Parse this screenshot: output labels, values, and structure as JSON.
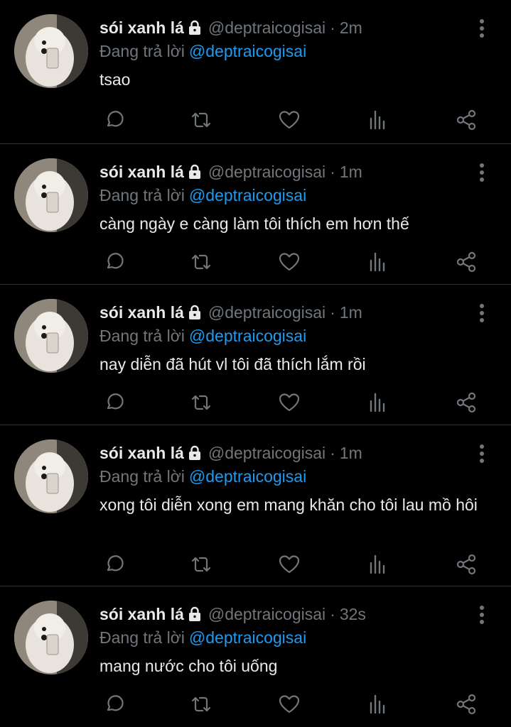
{
  "colors": {
    "background": "#000000",
    "text": "#e7e9ea",
    "muted": "#71767b",
    "link": "#1d9bf0",
    "divider": "#2f3336"
  },
  "icons": {
    "lock": "lock-icon",
    "more": "more-vertical-icon",
    "reply": "reply-icon",
    "retweet": "retweet-icon",
    "like": "heart-icon",
    "views": "views-icon",
    "share": "share-icon"
  },
  "tweets": [
    {
      "name": "sói xanh lá",
      "handle": "@deptraicogisai",
      "sep": "·",
      "time": "2m",
      "reply_prefix": "Đang trả lời",
      "reply_to": "@deptraicogisai",
      "text": "tsao"
    },
    {
      "name": "sói xanh lá",
      "handle": "@deptraicogisai",
      "sep": "·",
      "time": "1m",
      "reply_prefix": "Đang trả lời",
      "reply_to": "@deptraicogisai",
      "text": "càng ngày e càng làm tôi thích em hơn thế"
    },
    {
      "name": "sói xanh lá",
      "handle": "@deptraicogisai",
      "sep": "·",
      "time": "1m",
      "reply_prefix": "Đang trả lời",
      "reply_to": "@deptraicogisai",
      "text": "nay diễn đã hút vl tôi đã thích lắm rồi"
    },
    {
      "name": "sói xanh lá",
      "handle": "@deptraicogisai",
      "sep": "·",
      "time": "1m",
      "reply_prefix": "Đang trả lời",
      "reply_to": "@deptraicogisai",
      "text": "xong tôi diễn xong em mang khăn cho tôi lau mồ hôi"
    },
    {
      "name": "sói xanh lá",
      "handle": "@deptraicogisai",
      "sep": "·",
      "time": "32s",
      "reply_prefix": "Đang trả lời",
      "reply_to": "@deptraicogisai",
      "text": "mang nước cho tôi uống"
    }
  ]
}
